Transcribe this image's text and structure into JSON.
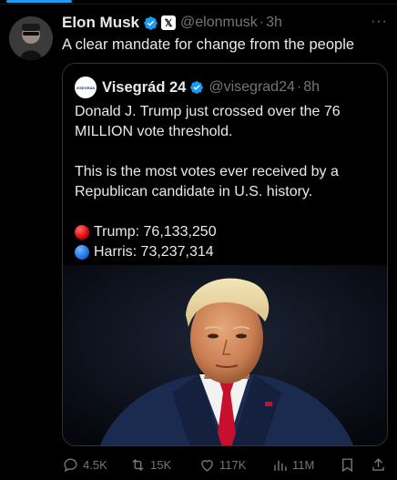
{
  "author": {
    "name": "Elon Musk",
    "handle": "@elonmusk",
    "separator": "·",
    "time": "3h",
    "affiliation_badge": "𝕏"
  },
  "tweet": {
    "text": "A clear mandate for change from the people"
  },
  "quote": {
    "avatar_label": "VISEGRÁD",
    "name": "Visegrád 24",
    "handle": "@visegrad24",
    "separator": "·",
    "time": "8h",
    "paragraph1": "Donald J. Trump just crossed over the 76 MILLION vote threshold.",
    "paragraph2": "This is the most votes ever received by a Republican candidate in U.S. history.",
    "trump_line": "Trump: 76,133,250",
    "harris_line": "Harris: 73,237,314"
  },
  "metrics": {
    "replies": "4.5K",
    "retweets": "15K",
    "likes": "117K",
    "views": "11M"
  },
  "colors": {
    "accent": "#1d9bf0",
    "muted": "#71767b",
    "text": "#e7e9ea",
    "background": "#000000"
  },
  "icons": [
    "verified-badge-icon",
    "x-affiliation-icon",
    "more-icon",
    "reply-icon",
    "retweet-icon",
    "like-icon",
    "views-icon",
    "bookmark-icon",
    "share-icon"
  ]
}
